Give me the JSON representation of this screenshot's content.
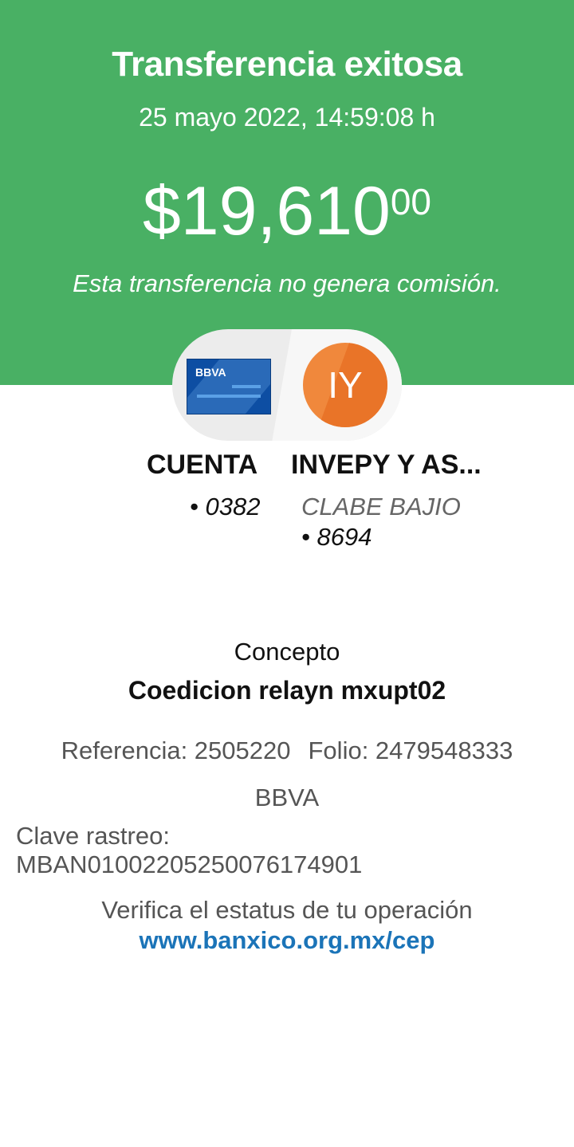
{
  "header": {
    "title": "Transferencia exitosa",
    "datetime": "25 mayo 2022, 14:59:08 h",
    "amount_main": "$19,610",
    "amount_cents": "00",
    "fee_note": "Esta transferencia no genera comisión."
  },
  "origin": {
    "card_brand": "BBVA",
    "name": "CUENTA",
    "account": "• 0382"
  },
  "destination": {
    "initials": "IY",
    "name": "INVEPY Y AS...",
    "bank": "CLABE BAJIO",
    "account": "• 8694"
  },
  "details": {
    "concepto_label": "Concepto",
    "concepto_value": "Coedicion relayn mxupt02",
    "referencia": "Referencia: 2505220",
    "folio": "Folio: 2479548333",
    "bank": "BBVA",
    "clave_label": "Clave rastreo:",
    "clave_value": "MBAN01002205250076174901",
    "verify_text": "Verifica el estatus de tu operación",
    "verify_link": "www.banxico.org.mx/cep"
  },
  "colors": {
    "header_bg": "#49b064",
    "card_blue": "#0d4ea3",
    "avatar_orange": "#f0883c",
    "link_blue": "#1b74b8"
  }
}
